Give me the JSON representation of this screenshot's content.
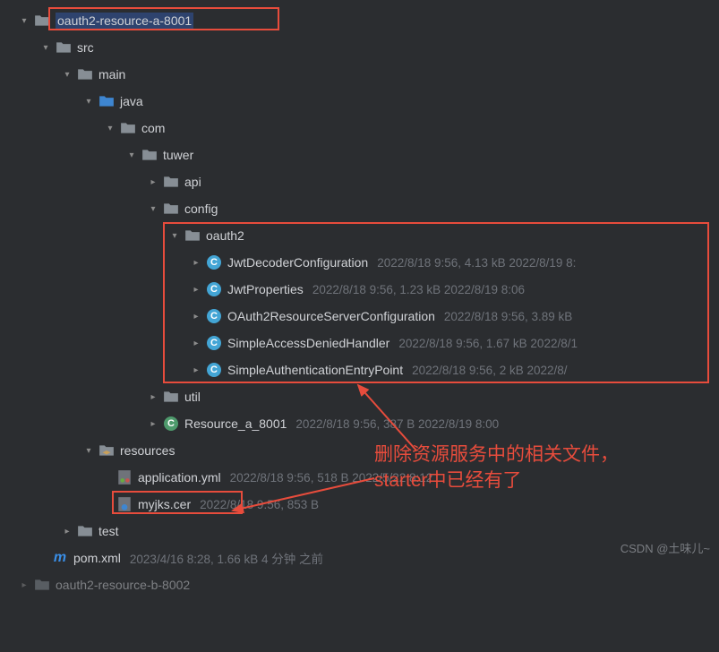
{
  "tree": {
    "root_name": "oauth2-resource-a-8001",
    "src": "src",
    "main": "main",
    "java": "java",
    "com": "com",
    "tuwer": "tuwer",
    "api": "api",
    "config": "config",
    "oauth2": "oauth2",
    "util": "util",
    "resources": "resources",
    "test": "test",
    "classes": {
      "jwt_decoder": {
        "name": "JwtDecoderConfiguration",
        "meta": "2022/8/18 9:56, 4.13 kB 2022/8/19 8:"
      },
      "jwt_props": {
        "name": "JwtProperties",
        "meta": "2022/8/18 9:56, 1.23 kB 2022/8/19 8:06"
      },
      "oauth2_cfg": {
        "name": "OAuth2ResourceServerConfiguration",
        "meta": "2022/8/18 9:56, 3.89 kB"
      },
      "denied": {
        "name": "SimpleAccessDeniedHandler",
        "meta": "2022/8/18 9:56, 1.67 kB 2022/8/1"
      },
      "entry": {
        "name": "SimpleAuthenticationEntryPoint",
        "meta": "2022/8/18 9:56, 2 kB 2022/8/"
      }
    },
    "resource_a": {
      "name": "Resource_a_8001",
      "meta": "2022/8/18 9:56, 387 B 2022/8/19 8:00"
    },
    "app_yml": {
      "name": "application.yml",
      "meta": "2022/8/18 9:56, 518 B 2022/5/22 8:12"
    },
    "cer": {
      "name": "myjks.cer",
      "meta": "2022/8/18 9:56, 853 B"
    },
    "pom": {
      "name": "pom.xml",
      "meta": "2023/4/16 8:28, 1.66 kB 4 分钟 之前"
    },
    "truncated": "oauth2-resource-b-8002"
  },
  "annotation": {
    "line1": "删除资源服务中的相关文件，",
    "line2": "starter中已经有了"
  },
  "watermark": "CSDN @土味儿~"
}
